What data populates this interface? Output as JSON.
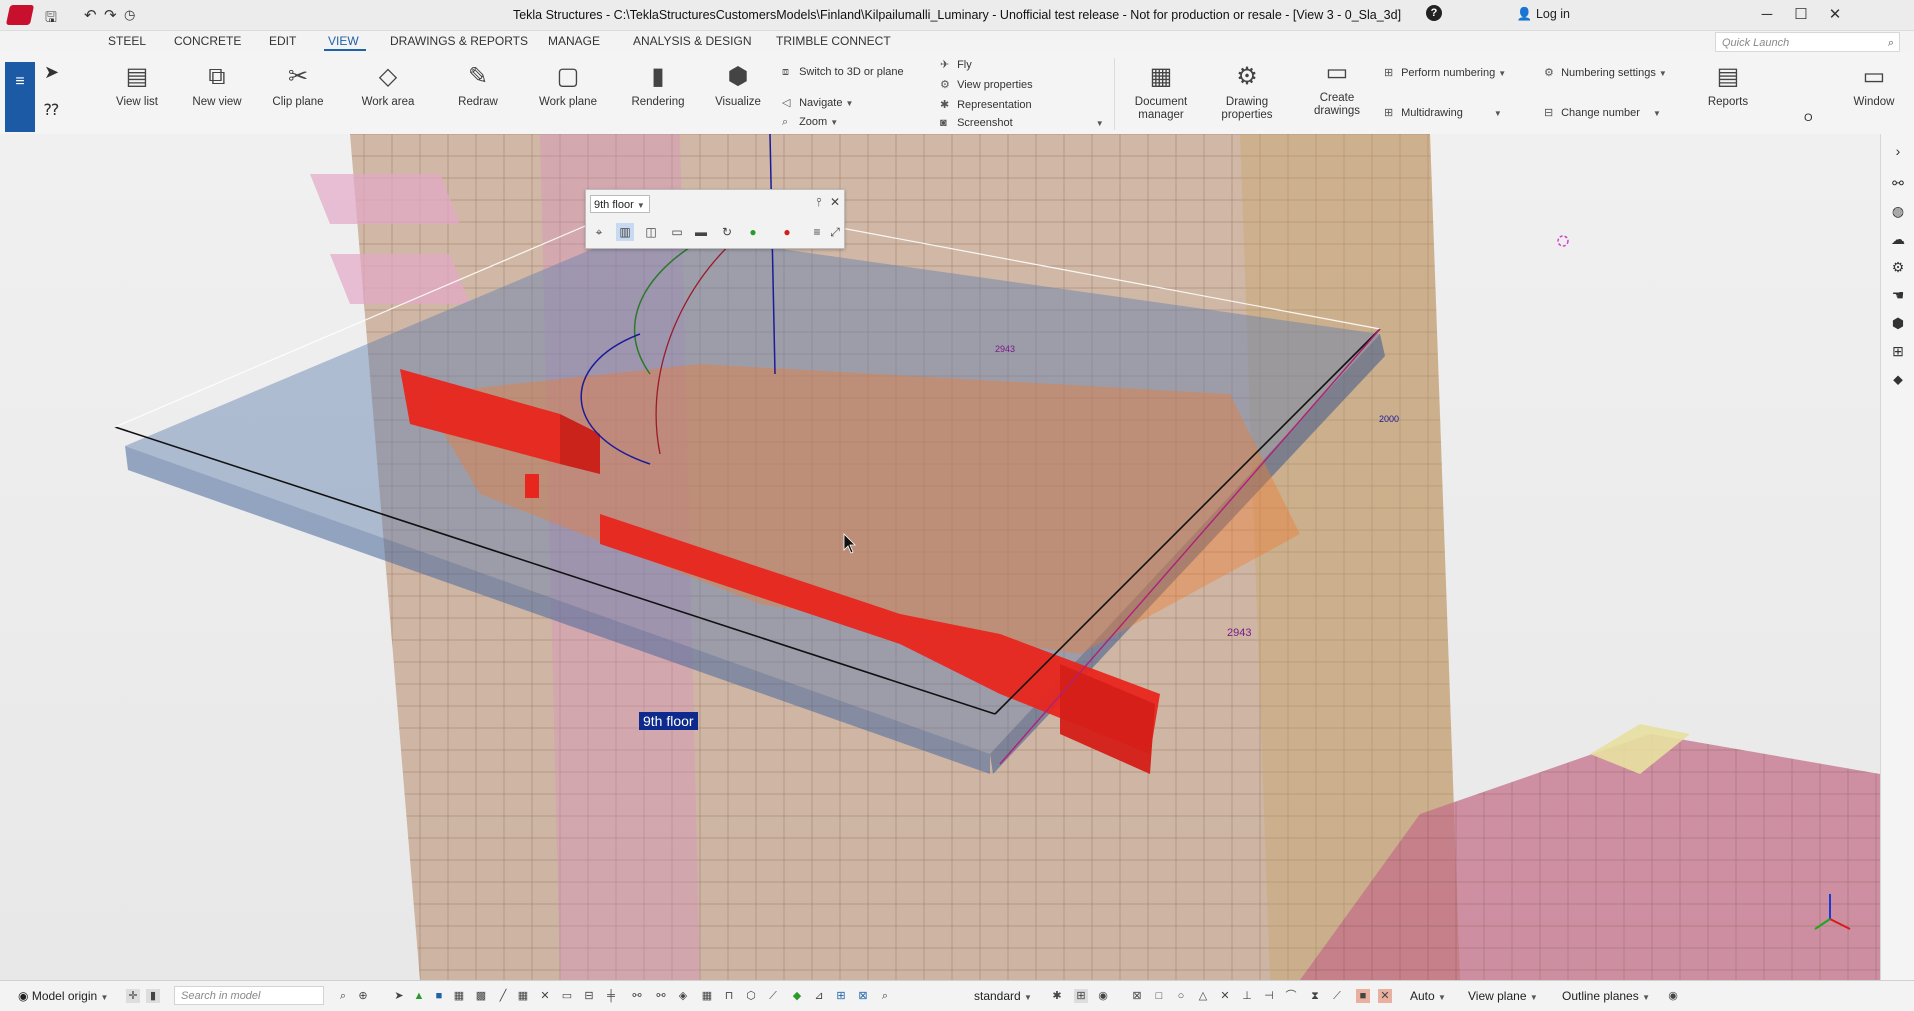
{
  "window": {
    "title": "Tekla Structures - C:\\TeklaStructuresCustomersModels\\Finland\\Kilpailumalli_Luminary - Unofficial test release - Not for production or resale - [View 3 - 0_Sla_3d]",
    "login": "Log in",
    "help": "?"
  },
  "menu_tabs": [
    "STEEL",
    "CONCRETE",
    "EDIT",
    "VIEW",
    "DRAWINGS & REPORTS",
    "MANAGE",
    "ANALYSIS & DESIGN",
    "TRIMBLE CONNECT"
  ],
  "active_tab": "VIEW",
  "quick_launch": {
    "placeholder": "Quick Launch"
  },
  "ribbon": {
    "view_list": "View list",
    "new_view": "New view",
    "clip_plane": "Clip plane",
    "work_area": "Work area",
    "redraw": "Redraw",
    "work_plane": "Work plane",
    "rendering": "Rendering",
    "visualize": "Visualize",
    "switch_3d": "Switch to 3D or plane",
    "navigate": "Navigate",
    "zoom": "Zoom",
    "fly": "Fly",
    "view_properties": "View properties",
    "representation": "Representation",
    "screenshot": "Screenshot",
    "document_manager": "Document manager",
    "drawing_properties": "Drawing properties",
    "create_drawings": "Create drawings",
    "perform_numbering": "Perform numbering",
    "multidrawing": "Multidrawing",
    "numbering_settings": "Numbering settings",
    "change_number": "Change number",
    "reports": "Reports",
    "window": "Window",
    "o_label": "O"
  },
  "viewport": {
    "workplane_select": "9th floor",
    "floor_label": "9th floor",
    "dim1": "2000",
    "dim2": "2943",
    "dim3": "2943"
  },
  "statusbar": {
    "model_origin": "Model origin",
    "search_placeholder": "Search in model",
    "standard": "standard",
    "auto": "Auto",
    "view_plane": "View plane",
    "outline_planes": "Outline planes"
  },
  "colors": {
    "accent": "#1f62a8",
    "brand": "#c8102e",
    "wall_red": "#e8261e",
    "slab_blue": "#5f7fb0",
    "magenta": "#b0207a"
  }
}
